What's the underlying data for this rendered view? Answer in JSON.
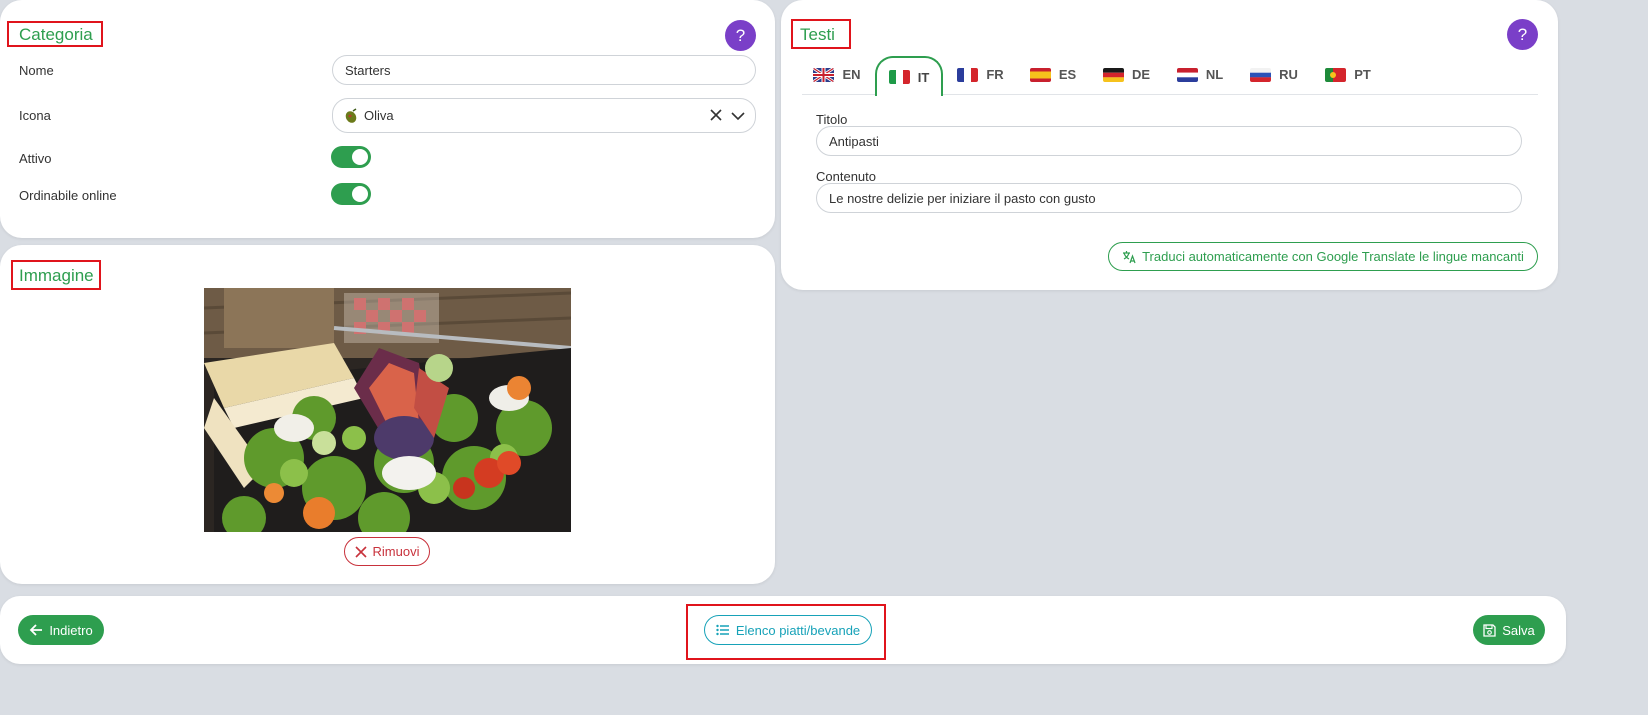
{
  "categoria": {
    "title": "Categoria",
    "help": "?",
    "fields": {
      "nome_label": "Nome",
      "nome_value": "Starters",
      "icona_label": "Icona",
      "icona_value": "Oliva",
      "attivo_label": "Attivo",
      "attivo_on": true,
      "ordinabile_label": "Ordinabile online",
      "ordinabile_on": true
    }
  },
  "immagine": {
    "title": "Immagine",
    "remove_label": "Rimuovi"
  },
  "testi": {
    "title": "Testi",
    "help": "?",
    "tabs": [
      {
        "code": "EN",
        "active": false
      },
      {
        "code": "IT",
        "active": true
      },
      {
        "code": "FR",
        "active": false
      },
      {
        "code": "ES",
        "active": false
      },
      {
        "code": "DE",
        "active": false
      },
      {
        "code": "NL",
        "active": false
      },
      {
        "code": "RU",
        "active": false
      },
      {
        "code": "PT",
        "active": false
      }
    ],
    "titolo_label": "Titolo",
    "titolo_value": "Antipasti",
    "contenuto_label": "Contenuto",
    "contenuto_value": "Le nostre delizie per iniziare il pasto con gusto",
    "translate_label": "Traduci automaticamente con Google Translate le lingue mancanti"
  },
  "footer": {
    "back_label": "Indietro",
    "list_label": "Elenco piatti/bevande",
    "save_label": "Salva"
  },
  "colors": {
    "accent_green": "#2e9e4f",
    "help_purple": "#7a3fc8",
    "danger_red": "#c8323c",
    "teal": "#17a2b8"
  }
}
